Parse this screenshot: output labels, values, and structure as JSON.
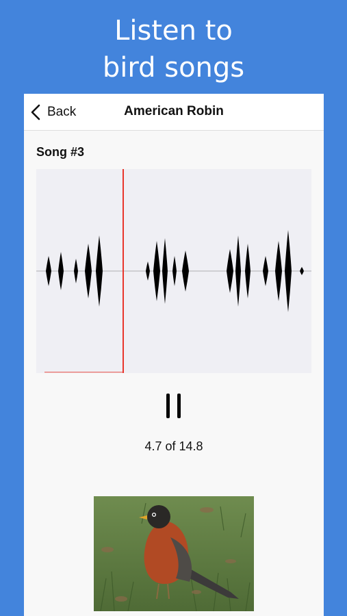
{
  "headline": {
    "line1": "Listen to",
    "line2": "bird songs"
  },
  "navbar": {
    "back_label": "Back",
    "title": "American Robin"
  },
  "song": {
    "label": "Song #3"
  },
  "playback": {
    "position": 4.7,
    "duration": 14.8,
    "readout": "4.7 of 14.8",
    "state": "playing"
  },
  "colors": {
    "background": "#4384dc",
    "playhead": "#e8352b",
    "waveform_box": "#efeff4"
  },
  "icons": {
    "back": "chevron-left-icon",
    "pause": "pause-icon"
  },
  "photo": {
    "subject": "American Robin"
  }
}
